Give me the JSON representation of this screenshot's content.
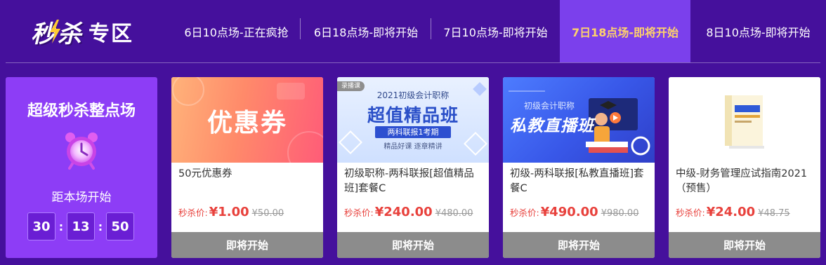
{
  "logo": {
    "miao": "秒",
    "sha": "杀",
    "zhuanqu": "专区"
  },
  "sessions": [
    {
      "label": "6日10点场-正在疯抢",
      "active": false
    },
    {
      "label": "6日18点场-即将开始",
      "active": false
    },
    {
      "label": "7日10点场-即将开始",
      "active": false
    },
    {
      "label": "7日18点场-即将开始",
      "active": true
    },
    {
      "label": "8日10点场-即将开始",
      "active": false
    }
  ],
  "countdown": {
    "title": "超级秒杀整点场",
    "subtitle": "距本场开始",
    "hours": "30",
    "minutes": "13",
    "seconds": "50",
    "separator": ":"
  },
  "products": [
    {
      "name": "50元优惠券",
      "price_label": "秒杀价:",
      "price": "¥1.00",
      "original_price": "¥50.00",
      "button": "即将开始",
      "thumb": {
        "main": "优惠券"
      }
    },
    {
      "name": "初级职称-两科联报[超值精品班]套餐C",
      "price_label": "秒杀价:",
      "price": "¥240.00",
      "original_price": "¥480.00",
      "button": "即将开始",
      "thumb": {
        "badge": "录播课",
        "sub": "2021初级会计职称",
        "main": "超值精品班",
        "pill": "两科联报1考期",
        "foot": "精品好课 逐章精讲"
      }
    },
    {
      "name": "初级-两科联报[私教直播班]套餐C",
      "price_label": "秒杀价:",
      "price": "¥490.00",
      "original_price": "¥980.00",
      "button": "即将开始",
      "thumb": {
        "sub": "初级会计职称",
        "main": "私教直播班"
      }
    },
    {
      "name": "中级-财务管理应试指南2021（预售）",
      "price_label": "秒杀价:",
      "price": "¥24.00",
      "original_price": "¥48.75",
      "button": "即将开始",
      "thumb": {}
    }
  ],
  "colors": {
    "background": "#45109c",
    "active_tab": "#7b40ec",
    "active_text": "#ffd26b",
    "countdown_card": "#8d3df6",
    "price_red": "#e8413c",
    "button_gray": "#8c8c8c"
  }
}
